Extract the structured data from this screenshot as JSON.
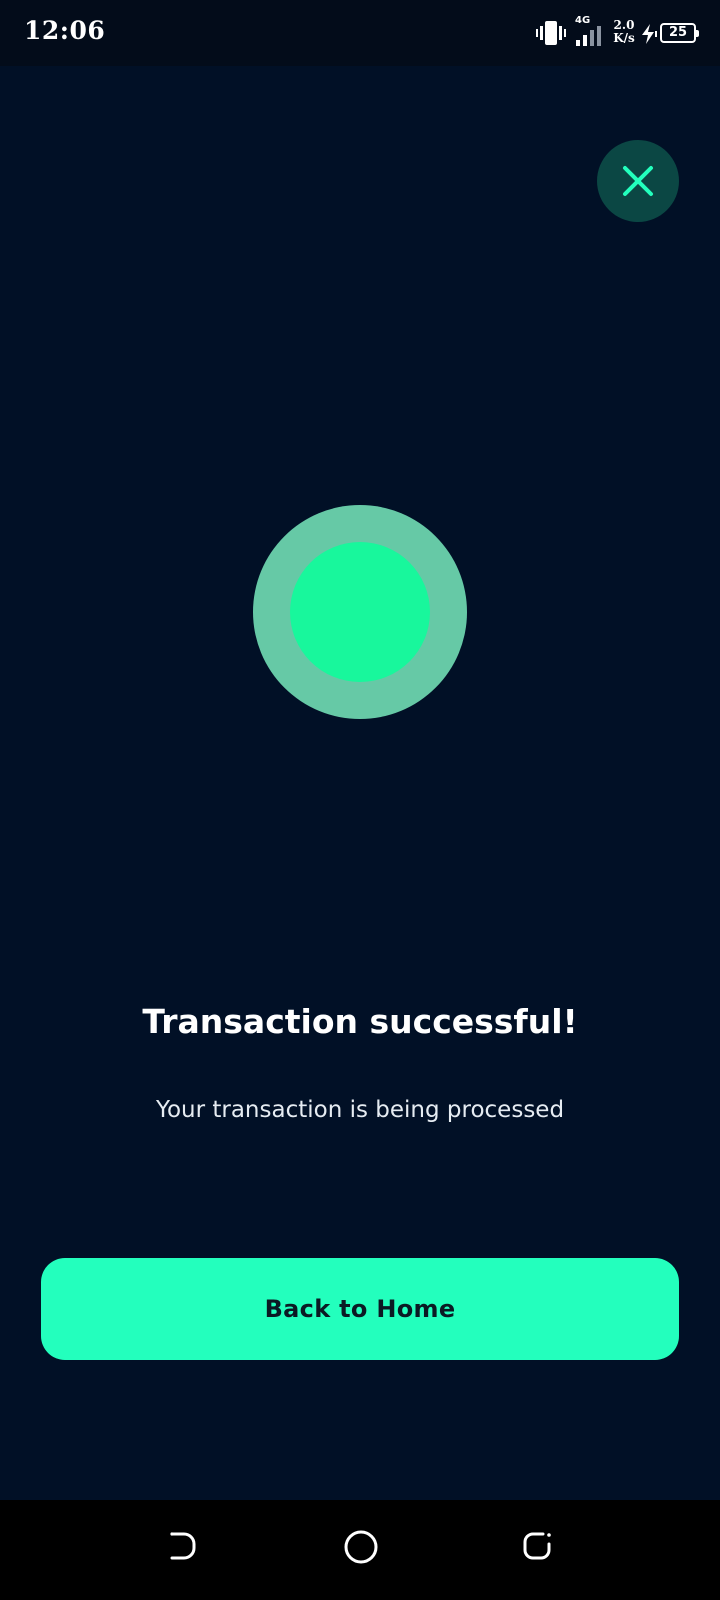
{
  "status_bar": {
    "time": "12:06",
    "network_type": "4G",
    "net_speed_value": "2.0",
    "net_speed_unit": "K/s",
    "battery_level": "25",
    "icons": [
      "vibrate-icon",
      "signal-icon",
      "charging-icon",
      "battery-icon"
    ]
  },
  "colors": {
    "background": "#011026",
    "accent": "#23ffbd",
    "success_outer": "#66c9a6",
    "success_inner": "#18f79c",
    "close_button_bg": "#0b4744"
  },
  "close_button": {
    "icon": "close-icon"
  },
  "success_indicator": {
    "icon": "success-circle-icon"
  },
  "message": {
    "title": "Transaction successful!",
    "subtitle": "Your transaction is being processed"
  },
  "primary_button": {
    "label": "Back to Home"
  },
  "nav_bar": {
    "icons": [
      "back-icon",
      "home-icon",
      "recents-icon"
    ]
  }
}
